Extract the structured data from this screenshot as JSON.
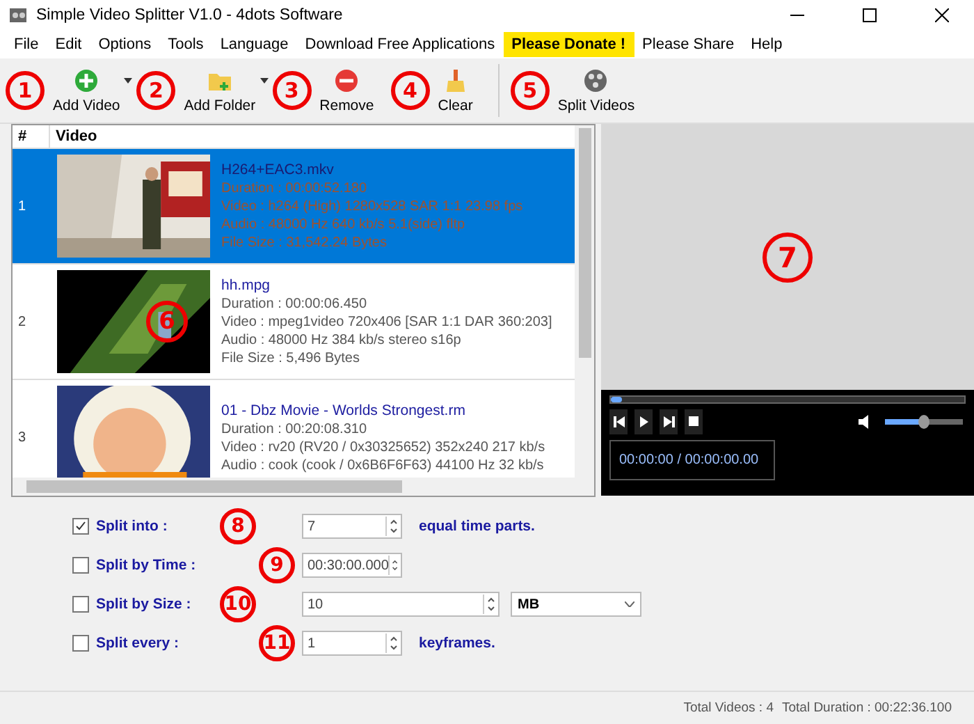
{
  "window": {
    "title": "Simple Video Splitter V1.0 - 4dots Software"
  },
  "menu": [
    {
      "label": "File",
      "kind": "plain"
    },
    {
      "label": "Edit",
      "kind": "plain"
    },
    {
      "label": "Options",
      "kind": "plain"
    },
    {
      "label": "Tools",
      "kind": "plain"
    },
    {
      "label": "Language",
      "kind": "plain"
    },
    {
      "label": "Download Free Applications",
      "kind": "plain"
    },
    {
      "label": "Please Donate !",
      "kind": "highlight"
    },
    {
      "label": "Please Share",
      "kind": "plain"
    },
    {
      "label": "Help",
      "kind": "plain"
    }
  ],
  "toolbar": [
    {
      "label": "Add Video",
      "kind": "add",
      "dropdown": true,
      "callout": "1"
    },
    {
      "label": "Add Folder",
      "kind": "folder",
      "dropdown": true,
      "callout": "2"
    },
    {
      "label": "Remove",
      "kind": "remove",
      "dropdown": false,
      "callout": "3"
    },
    {
      "label": "Clear",
      "kind": "clear",
      "dropdown": false,
      "callout": "4"
    },
    {
      "label": "Split Videos",
      "kind": "split",
      "dropdown": false,
      "callout": "5"
    }
  ],
  "table": {
    "columns": [
      "#",
      "Video"
    ],
    "callout": "6",
    "rows": [
      {
        "number": "1",
        "selected": true,
        "title": "H264+EAC3.mkv",
        "details": [
          "Duration : 00:00:52.180",
          "Video : h264 (High) 1280x528 SAR 1:1 23.98 fps",
          "Audio :  48000 Hz 640 kb/s 5.1(side) fltp",
          "File Size : 31,542.24 Bytes"
        ]
      },
      {
        "number": "2",
        "selected": false,
        "title": "hh.mpg",
        "details": [
          "Duration : 00:00:06.450",
          "Video : mpeg1video 720x406 [SAR 1:1 DAR 360:203]",
          "Audio :  48000 Hz 384 kb/s stereo s16p",
          "File Size : 5,496 Bytes"
        ]
      },
      {
        "number": "3",
        "selected": false,
        "title": "01 - Dbz Movie - Worlds Strongest.rm",
        "details": [
          "Duration : 00:20:08.310",
          "Video : rv20 (RV20 / 0x30325652) 352x240 217 kb/s",
          "Audio : cook (cook / 0x6B6F6F63) 44100 Hz 32 kb/s"
        ]
      }
    ]
  },
  "player": {
    "callout": "7",
    "seek": {
      "level": 0.03
    },
    "volume": {
      "level": 0.5
    },
    "time": "00:00:00 / 00:00:00.00"
  },
  "options": [
    {
      "label": "Split into :",
      "checked": true,
      "kind": "spin",
      "value": "7",
      "suffix": "equal time parts.",
      "callout": "8"
    },
    {
      "label": "Split by Time :",
      "checked": false,
      "kind": "spin",
      "value": "00:30:00.000",
      "callout": "9"
    },
    {
      "label": "Split by Size :",
      "checked": false,
      "kind": "spin-wide",
      "value": "10",
      "unit": "MB",
      "callout": "10"
    },
    {
      "label": "Split every :",
      "checked": false,
      "kind": "spin",
      "value": "1",
      "suffix": "keyframes.",
      "callout": "11"
    }
  ],
  "status_bar": [
    "Total Videos : 4",
    "Total Duration : 00:22:36.100"
  ]
}
